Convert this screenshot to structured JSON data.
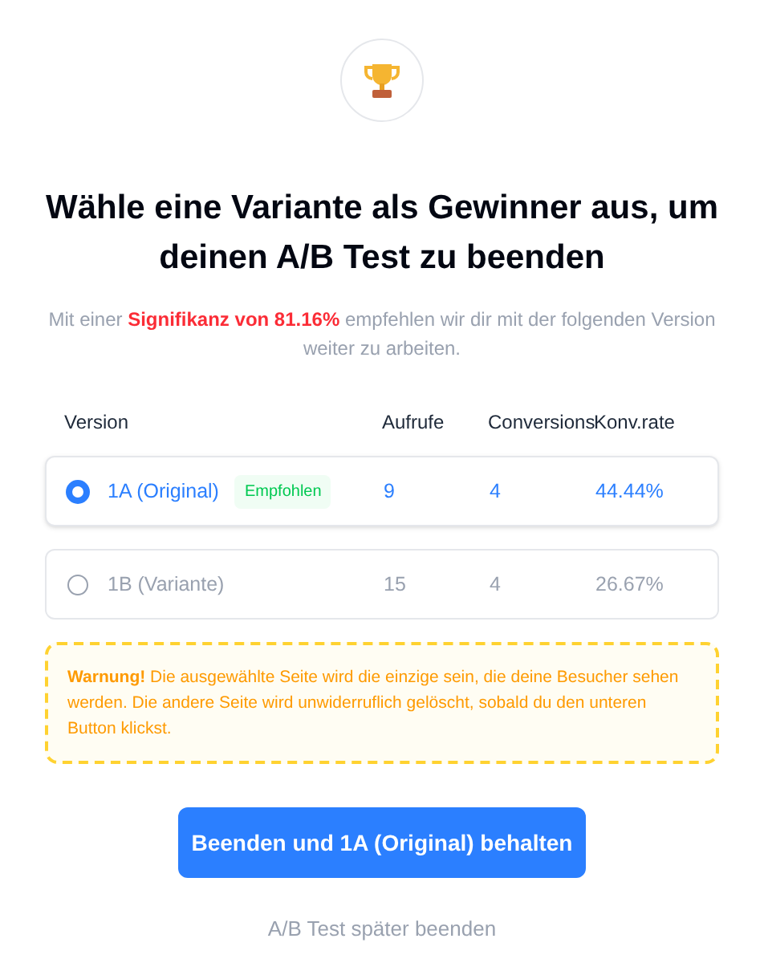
{
  "title": "Wähle eine Variante als Gewinner aus, um deinen A/B Test zu beenden",
  "subtitle": "Mit einer **Signifikanz von 81.16%** empfehlen wir dir mit der folgenden Version weiter zu arbeiten.",
  "table": {
    "columns": [
      "Version",
      "Aufrufe",
      "Conversions",
      "Konv.rate"
    ],
    "rows": [
      {
        "name": "1A (Original)",
        "badge": "Empfohlen",
        "views": "9",
        "conversions": "4",
        "rate": "44.44%",
        "selected": true
      },
      {
        "name": "1B (Variante)",
        "views": "15",
        "conversions": "4",
        "rate": "26.67%",
        "selected": false
      }
    ]
  },
  "warning": "**Warnung!** Die ausgewählte Seite wird die einzige sein, die deine Besucher sehen werden. Die andere Seite wird unwiderruflich gelöscht, sobald du den unteren Button klickst.",
  "primary_button": "Beenden und 1A (Original) behalten",
  "secondary_link": "A/B Test später beenden"
}
